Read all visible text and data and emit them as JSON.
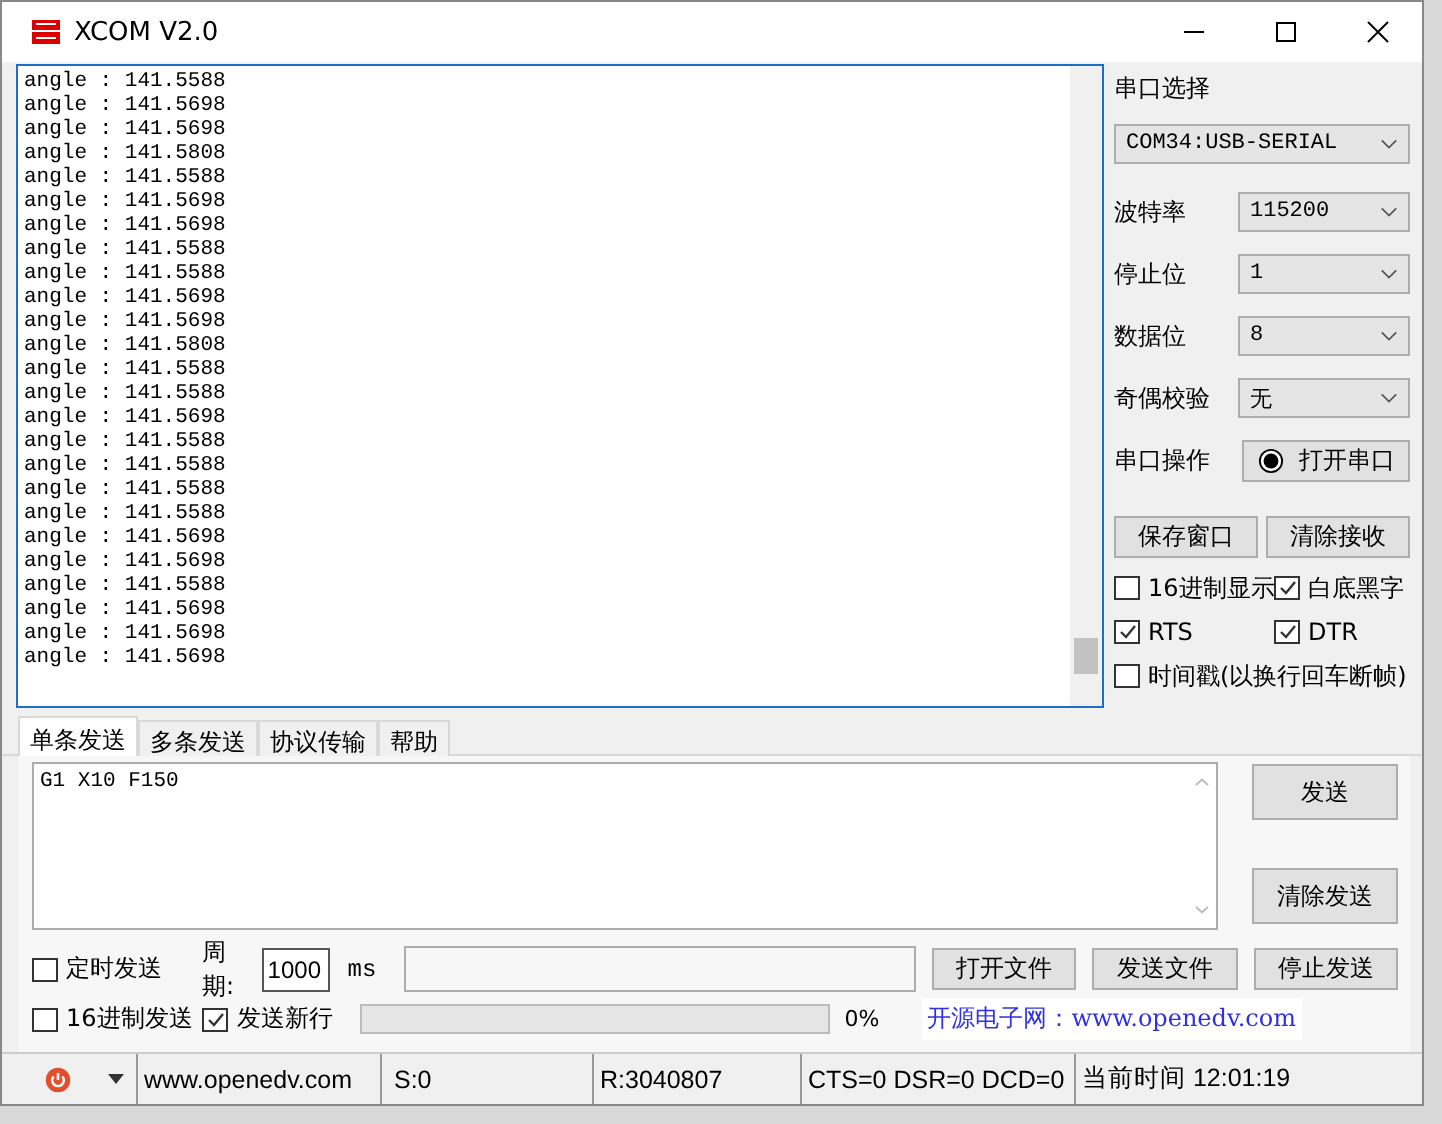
{
  "window": {
    "title": "XCOM V2.0"
  },
  "receive": {
    "lines": [
      "angle : 141.5588",
      "angle : 141.5698",
      "angle : 141.5698",
      "angle : 141.5808",
      "angle : 141.5588",
      "angle : 141.5698",
      "angle : 141.5698",
      "angle : 141.5588",
      "angle : 141.5588",
      "angle : 141.5698",
      "angle : 141.5698",
      "angle : 141.5808",
      "angle : 141.5588",
      "angle : 141.5588",
      "angle : 141.5698",
      "angle : 141.5588",
      "angle : 141.5588",
      "angle : 141.5588",
      "angle : 141.5588",
      "angle : 141.5698",
      "angle : 141.5698",
      "angle : 141.5588",
      "angle : 141.5698",
      "angle : 141.5698",
      "angle : 141.5698"
    ]
  },
  "port_panel": {
    "title": "串口选择",
    "port": "COM34:USB-SERIAL",
    "settings": [
      {
        "label": "波特率",
        "value": "115200"
      },
      {
        "label": "停止位",
        "value": "1"
      },
      {
        "label": "数据位",
        "value": "8"
      },
      {
        "label": "奇偶校验",
        "value": "无"
      }
    ],
    "operation": {
      "label": "串口操作",
      "button": "打开串口"
    },
    "buttons": [
      "保存窗口",
      "清除接收"
    ],
    "option_rows": [
      {
        "items": [
          {
            "label": "16进制显示",
            "checked": false
          },
          {
            "label": "白底黑字",
            "checked": true
          }
        ]
      },
      {
        "items": [
          {
            "label": "RTS",
            "checked": true
          },
          {
            "label": "DTR",
            "checked": true
          }
        ]
      },
      {
        "items": [
          {
            "label": "时间戳(以换行回车断帧)",
            "checked": false
          }
        ]
      }
    ]
  },
  "tabs": [
    {
      "label": "单条发送",
      "selected": true
    },
    {
      "label": "多条发送",
      "selected": false
    },
    {
      "label": "协议传输",
      "selected": false
    },
    {
      "label": "帮助",
      "selected": false
    }
  ],
  "send": {
    "text": "G1 X10 F150",
    "buttons": [
      "发送",
      "清除发送"
    ]
  },
  "timed_send": {
    "label": "定时发送",
    "checked": false
  },
  "period": {
    "label": "周期:",
    "value": "1000",
    "unit": "ms"
  },
  "file_buttons": [
    "打开文件",
    "发送文件",
    "停止发送"
  ],
  "hex_send": {
    "label": "16进制发送",
    "checked": false
  },
  "send_newline": {
    "label": "发送新行",
    "checked": true
  },
  "progress": {
    "level": 0,
    "reading": "0%"
  },
  "banner": "开源电子网：www.openedv.com",
  "status_bar": {
    "url": "www.openedv.com",
    "sent": "S:0",
    "received": "R:3040807",
    "signals": "CTS=0 DSR=0 DCD=0",
    "time": "当前时间 12:01:19"
  }
}
